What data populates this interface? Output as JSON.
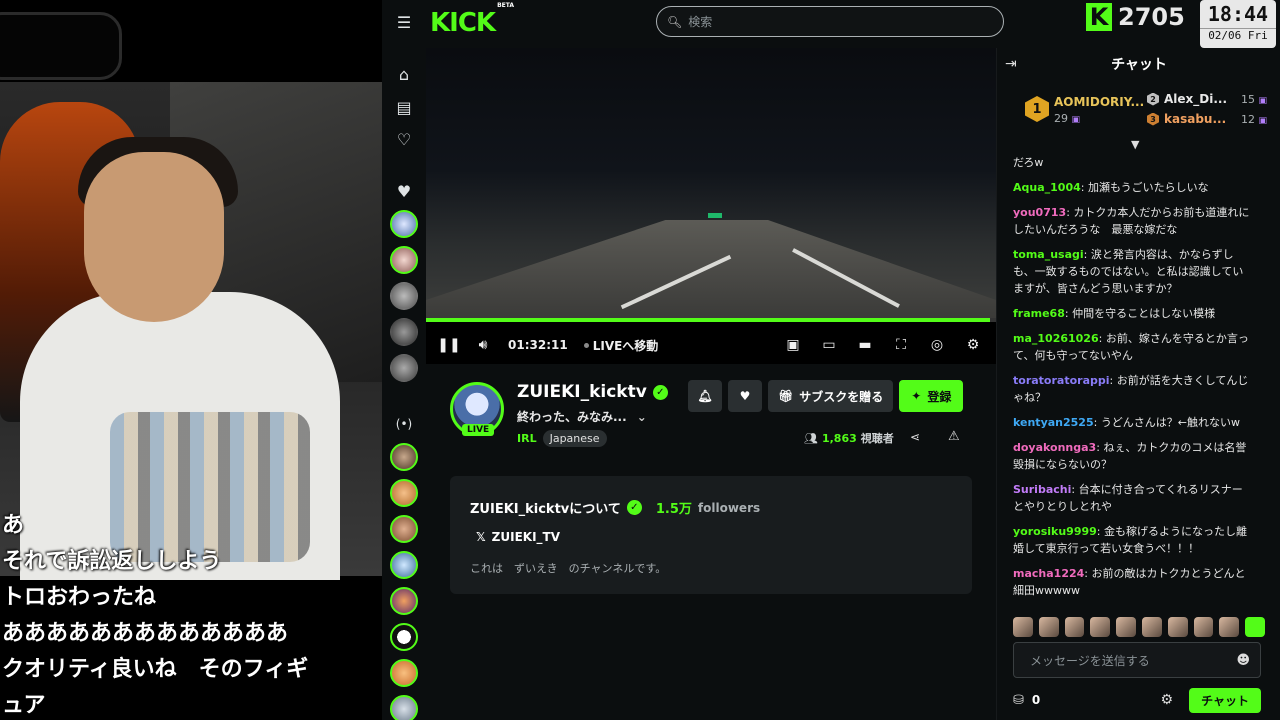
{
  "topbar": {
    "logo": "KICK",
    "logo_beta": "BETA",
    "search_placeholder": "検索",
    "viewer_badge": "2705"
  },
  "clock": {
    "time": "18:44",
    "date": "02/06 Fri"
  },
  "captions": [
    "あ",
    "それで訴訟返ししよう",
    "トロおわったね",
    "あああああああああああああ",
    "クオリティ良いね　そのフィギ",
    "ュア"
  ],
  "player": {
    "time": "01:32:11",
    "live_label": "LIVEへ移動",
    "progress": 0.99
  },
  "channel": {
    "name": "ZUIEKI_kicktv",
    "title": "終わった、みなみ...",
    "live_badge": "LIVE",
    "category": "IRL",
    "language": "Japanese",
    "gift_sub_label": "サブスクを贈る",
    "follow_label": "登録",
    "viewers_count": "1,863",
    "viewers_label": "視聴者"
  },
  "about": {
    "heading": "ZUIEKI_kicktvについて",
    "followers_count": "1.5万",
    "followers_label": "followers",
    "x_handle": "ZUIEKI_TV",
    "description": "これは　ずいえき　のチャンネルです。"
  },
  "chat": {
    "title": "チャット",
    "leaders": [
      {
        "rank": "1",
        "name": "AOMIDORIY...",
        "count": "29"
      },
      {
        "rank": "2",
        "name": "Alex_Di...",
        "count": "15"
      },
      {
        "rank": "3",
        "name": "kasabu...",
        "count": "12"
      }
    ],
    "messages": [
      {
        "user": "",
        "color": "#e6e6e6",
        "text": "だろw"
      },
      {
        "user": "Aqua_1004",
        "color": "#53fc18",
        "text": "加瀬もうごいたらしいな"
      },
      {
        "user": "you0713",
        "color": "#f06bbd",
        "text": "カトクカ本人だからお前も道連れにしたいんだろうな　最悪な嫁だな"
      },
      {
        "user": "toma_usagi",
        "color": "#53fc18",
        "text": "涙と発言内容は、かならずしも、一致するものではない。と私は認識していますが、皆さんどう思いますか？"
      },
      {
        "user": "frame68",
        "color": "#53fc18",
        "text": "仲間を守ることはしない模様"
      },
      {
        "user": "ma_10261026",
        "color": "#53fc18",
        "text": "お前、嫁さんを守るとか言って、何も守ってないやん"
      },
      {
        "user": "toratoratorappi",
        "color": "#8a7cf8",
        "text": "お前が話を大きくしてんじゃね？"
      },
      {
        "user": "kentyan2525",
        "color": "#3fa9f5",
        "text": "うどんさんは？←触れないw"
      },
      {
        "user": "doyakonnga3",
        "color": "#f06bbd",
        "text": "ねぇ、カトクカのコメは名誉毀損にならないの？"
      },
      {
        "user": "Suribachi",
        "color": "#c27cf8",
        "text": "台本に付き合ってくれるリスナーとやりとりしとれや"
      },
      {
        "user": "yorosiku9999",
        "color": "#53fc18",
        "text": "金も稼げるようになったし離婚して東京行って若い女食うべ！！！"
      },
      {
        "user": "macha1224",
        "color": "#f06bbd",
        "text": "お前の敵はカトクカとうどんと細田wwwww"
      }
    ],
    "input_placeholder": "メッセージを送信する",
    "points": "0",
    "send_label": "チャット"
  }
}
